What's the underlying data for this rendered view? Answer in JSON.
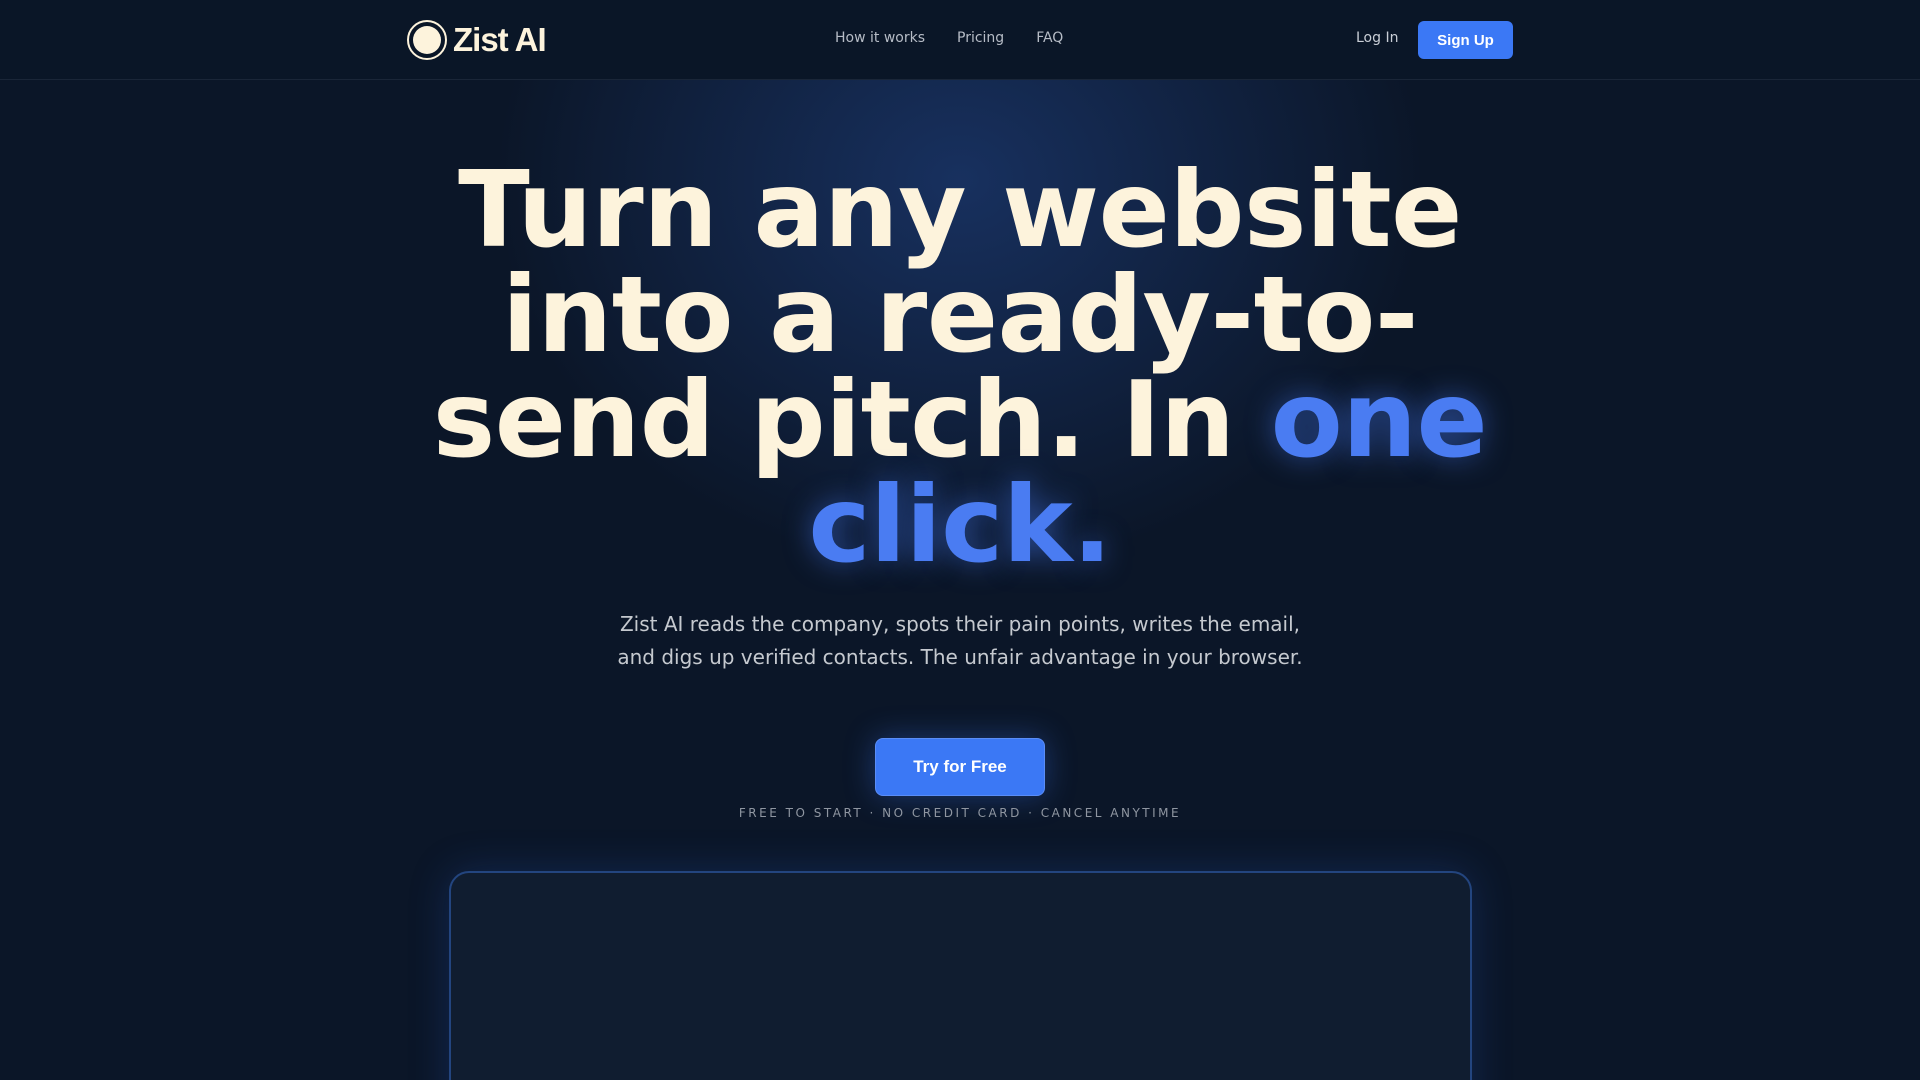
{
  "brand": {
    "name": "Zist AI",
    "icon": "circle-logo-icon"
  },
  "nav": {
    "links": [
      "How it works",
      "Pricing",
      "FAQ"
    ],
    "login_label": "Log In",
    "signup_label": "Sign Up"
  },
  "hero": {
    "headline_main": "Turn any website into a ready-to-send pitch. In ",
    "headline_accent": "one click.",
    "subcopy": "Zist AI reads the company, spots their pain points, writes the email, and digs up verified contacts. The unfair advantage in your browser.",
    "cta_label": "Try for Free",
    "fineprint": "FREE TO START · NO CREDIT CARD · CANCEL ANYTIME"
  },
  "colors": {
    "background": "#0b1628",
    "accent": "#3b78f5",
    "headline": "#fdf3dc"
  }
}
